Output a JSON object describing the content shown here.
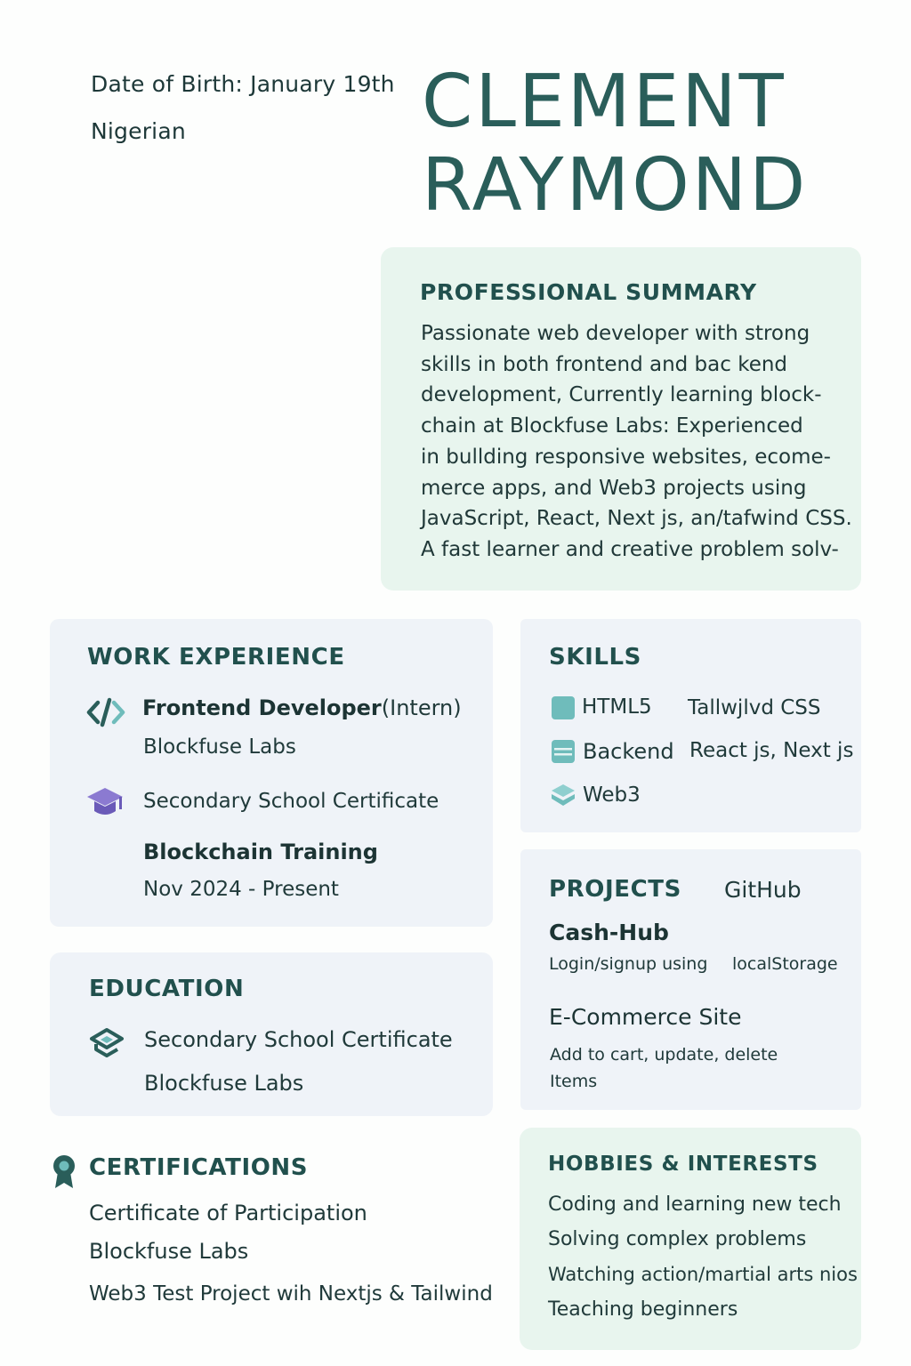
{
  "header": {
    "dob": "Date of Birth: January 19th",
    "nationality": "Nigerian",
    "first_name": "CLEMENT",
    "last_name": "RAYMOND"
  },
  "summary": {
    "title": "PROFESSIONAL SUMMARY",
    "lines": [
      "Passionate web developer with strong",
      "skills in both frontend and bac kend",
      "development, Currently learning block-",
      "chain at Blockfuse Labs: Experienced",
      "in bullding responsive websites, ecome-",
      "merce apps, and Web3 projects using",
      "JavaScript, React, Next js, an/tafwind CSS.",
      "A fast learner and creative problem solv-"
    ]
  },
  "work": {
    "title": "WORK EXPERIENCE",
    "role_main": "Frontend Developer",
    "role_suffix": "(Intern)",
    "company": "Blockfuse Labs",
    "cert": "Secondary School Certificate",
    "training": "Blockchain Training",
    "dates": "Nov 2024 - Present"
  },
  "skills": {
    "title": "SKILLS",
    "items": [
      "HTML5",
      "Tallwjlvd CSS",
      "Backend",
      "React js, Next js",
      "Web3"
    ]
  },
  "education": {
    "title": "EDUCATION",
    "cert": "Secondary School Certificate",
    "school": "Blockfuse Labs"
  },
  "projects": {
    "title": "PROJECTS",
    "link": "GitHub",
    "p1_name": "Cash-Hub",
    "p1_desc_a": "Login/signup using",
    "p1_desc_b": "localStorage",
    "p2_name": "E-Commerce Site",
    "p2_desc_a": "Add  to cart, update, delete",
    "p2_desc_b": "Items"
  },
  "certifications": {
    "title": "CERTIFICATIONS",
    "name": "Certificate of Participation",
    "issuer": "Blockfuse Labs",
    "project": "Web3 Test Project wih Nextjs & Tailwind"
  },
  "hobbies": {
    "title": "HOBBIES & INTERESTS",
    "items": [
      "Coding and learning new tech",
      "Solving complex problems",
      "Watching action/martial arts nios",
      "Teaching beginners"
    ]
  },
  "colors": {
    "accent": "#2a5e5a",
    "green_card": "#e8f5ee",
    "blue_card": "#eff3f8",
    "icon_teal": "#6fbcbb",
    "icon_purple": "#6a5ab8"
  },
  "icons": [
    "code-icon",
    "graduation-cap-icon",
    "square-icon",
    "list-icon",
    "layers-icon",
    "book-icon",
    "award-ribbon-icon"
  ]
}
